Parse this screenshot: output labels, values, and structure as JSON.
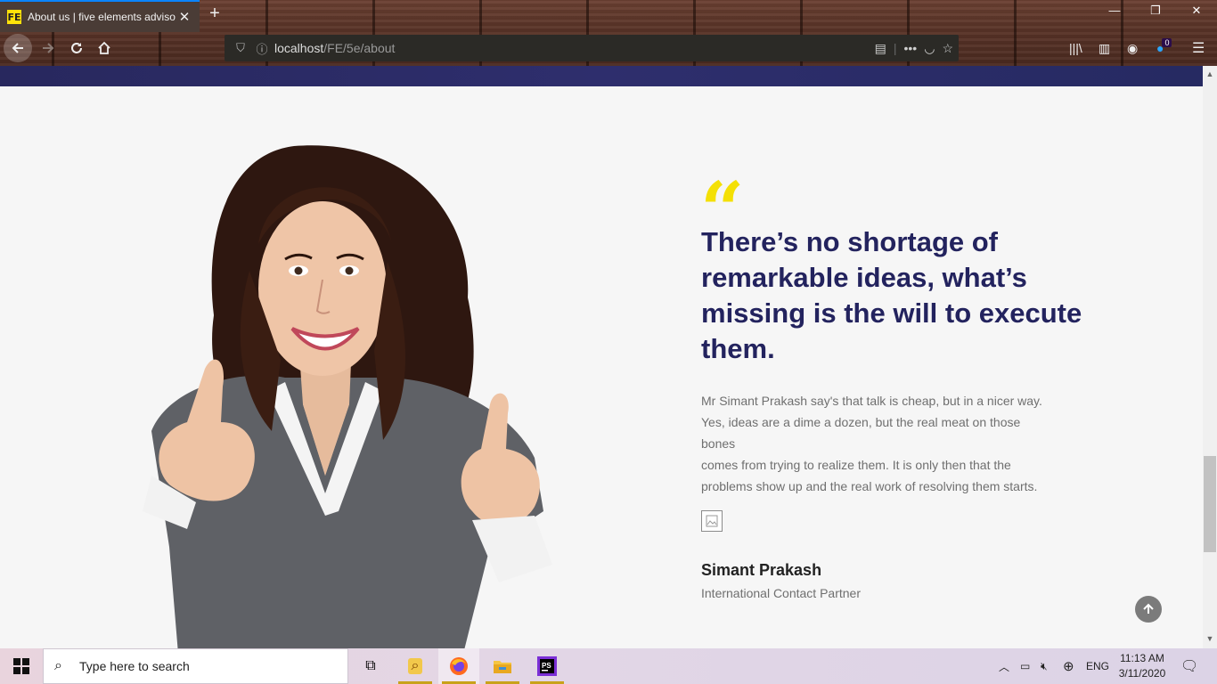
{
  "browser": {
    "tab_title": "About us | five elements adviso",
    "tab_favicon": "FE",
    "url_host": "localhost",
    "url_path": "/FE/5e/about",
    "notification_count": "0"
  },
  "content": {
    "quote_mark": "“",
    "headline": "There’s no shortage of remarkable ideas, what’s missing is the will to execute them.",
    "body_lines": [
      "Mr Simant Prakash say's that talk is cheap, but in a nicer way.",
      "Yes, ideas are a dime a dozen, but the real meat on those bones",
      "comes from trying to realize them. It is only then that the",
      "problems show up and the real work of resolving them starts."
    ],
    "person_name": "Simant Prakash",
    "person_role": "International Contact Partner"
  },
  "taskbar": {
    "search_placeholder": "Type here to search",
    "language": "ENG",
    "time": "11:13 AM",
    "date": "3/11/2020"
  },
  "colors": {
    "headline": "#23235e",
    "quote_accent": "#f4e005",
    "hero_strip": "#2b2b66"
  }
}
